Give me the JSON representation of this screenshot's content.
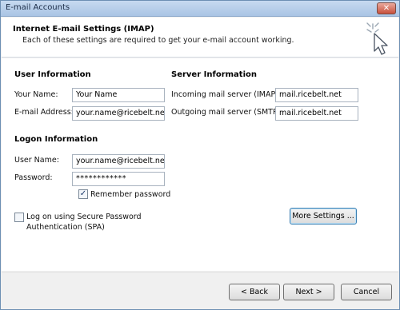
{
  "window": {
    "title": "E-mail Accounts",
    "close_glyph": "✕"
  },
  "header": {
    "title": "Internet E-mail Settings (IMAP)",
    "subtitle": "Each of these settings are required to get your e-mail account working."
  },
  "user_info": {
    "heading": "User Information",
    "name_label": "Your Name:",
    "name_value": "Your Name",
    "email_label": "E-mail Address:",
    "email_value": "your.name@ricebelt.net"
  },
  "server_info": {
    "heading": "Server Information",
    "incoming_label": "Incoming mail server (IMAP):",
    "incoming_value": "mail.ricebelt.net",
    "outgoing_label": "Outgoing mail server (SMTP):",
    "outgoing_value": "mail.ricebelt.net"
  },
  "logon_info": {
    "heading": "Logon Information",
    "username_label": "User Name:",
    "username_value": "your.name@ricebelt.net",
    "password_label": "Password:",
    "password_value": "************",
    "remember_label": "Remember password",
    "remember_checked": true,
    "spa_label_line1": "Log on using Secure Password",
    "spa_label_line2": "Authentication (SPA)",
    "spa_checked": false
  },
  "buttons": {
    "more_settings": "More Settings ...",
    "back": "< Back",
    "next": "Next >",
    "cancel": "Cancel"
  },
  "icons": {
    "checkmark": "✓"
  }
}
